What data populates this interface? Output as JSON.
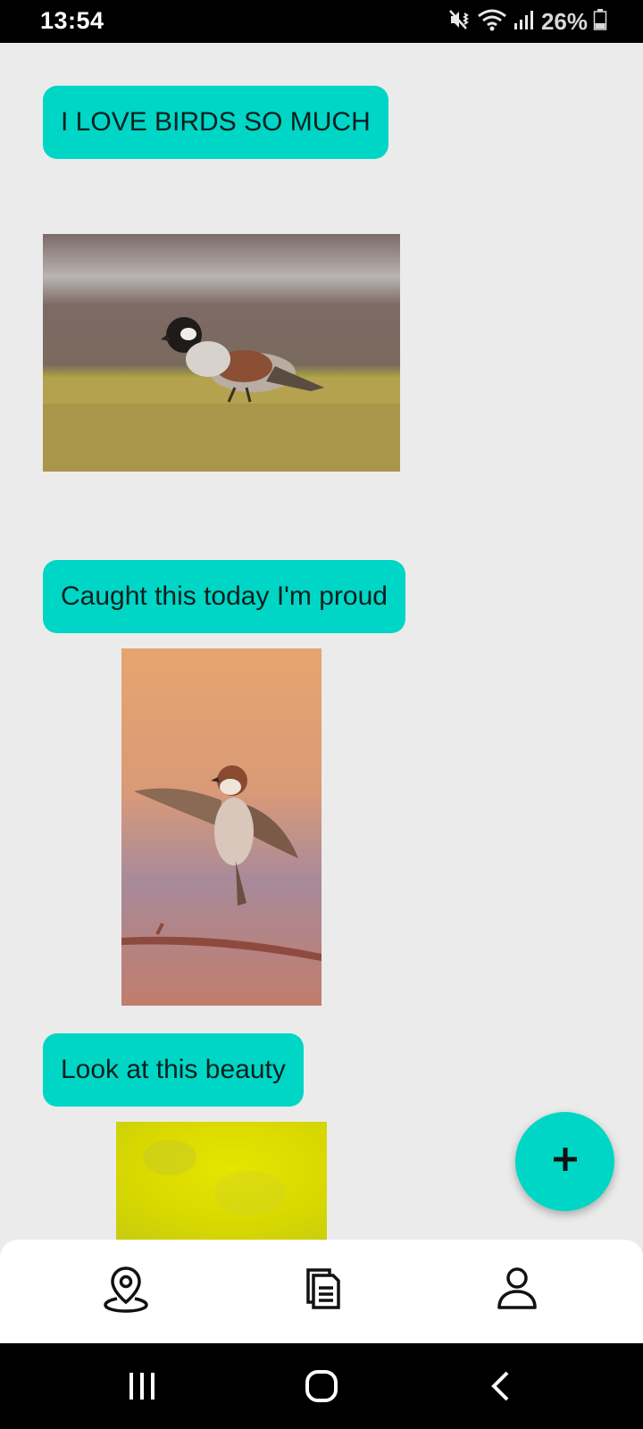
{
  "status_bar": {
    "time": "13:54",
    "battery_percent": "26%",
    "icons": [
      "mute-vibrate-icon",
      "wifi-icon",
      "signal-icon",
      "battery-icon"
    ]
  },
  "feed": {
    "posts": [
      {
        "caption": "I LOVE BIRDS SO MUCH",
        "image": "sparrow-on-grass-photo"
      },
      {
        "caption": "Caught this today I'm proud",
        "image": "sparrow-flying-over-branch-photo"
      },
      {
        "caption": "Look at this beauty",
        "image": "yellow-blurred-photo"
      }
    ]
  },
  "fab": {
    "icon": "plus-icon"
  },
  "bottom_nav": {
    "items": [
      {
        "icon": "map-pin-icon"
      },
      {
        "icon": "documents-icon"
      },
      {
        "icon": "profile-icon"
      }
    ]
  },
  "system_nav": {
    "buttons": [
      {
        "icon": "recents-icon"
      },
      {
        "icon": "home-icon"
      },
      {
        "icon": "back-icon"
      }
    ]
  },
  "colors": {
    "accent": "#00d6c6",
    "background": "#ebebeb",
    "nav_background": "#ffffff",
    "system_bars": "#000000"
  }
}
